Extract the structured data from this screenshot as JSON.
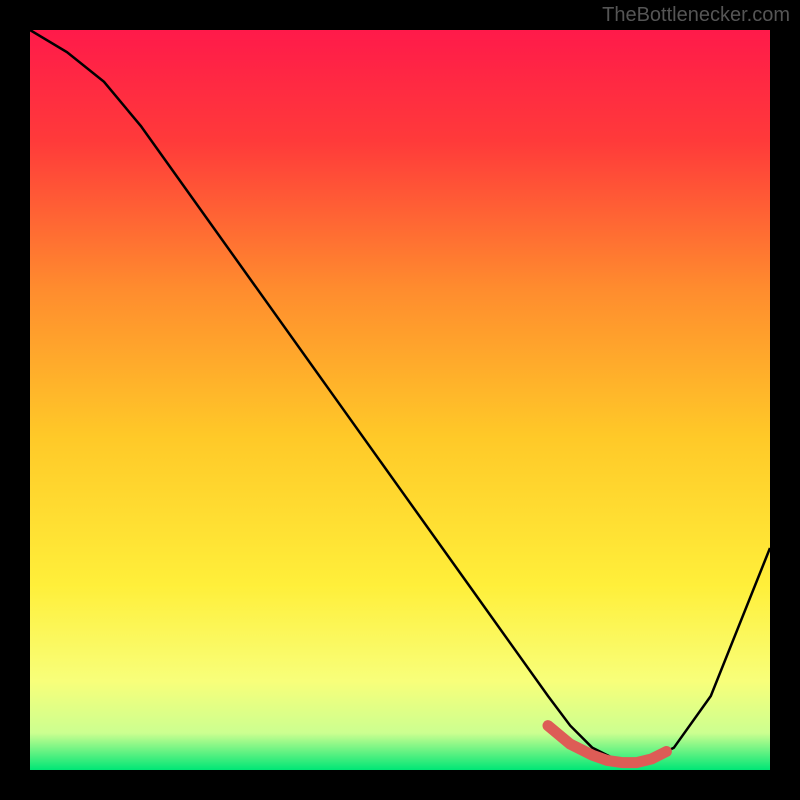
{
  "watermark": "TheBottlenecker.com",
  "chart_data": {
    "type": "line",
    "title": "",
    "xlabel": "",
    "ylabel": "",
    "xlim": [
      0,
      100
    ],
    "ylim": [
      0,
      100
    ],
    "series": [
      {
        "name": "curve",
        "x": [
          0,
          5,
          10,
          15,
          20,
          30,
          40,
          50,
          60,
          65,
          70,
          73,
          76,
          80,
          83,
          87,
          92,
          100
        ],
        "y": [
          100,
          97,
          93,
          87,
          80,
          66,
          52,
          38,
          24,
          17,
          10,
          6,
          3,
          1,
          1,
          3,
          10,
          30
        ]
      }
    ],
    "marker_segment": {
      "name": "highlight",
      "x": [
        70,
        73,
        76,
        78,
        80,
        82,
        84,
        86
      ],
      "y": [
        6,
        3.5,
        2,
        1.3,
        1,
        1,
        1.5,
        2.5
      ],
      "color": "#d9534f"
    },
    "gradient": {
      "top": "#ff1744",
      "mid_top": "#ff6f3c",
      "mid": "#ffc107",
      "mid_bottom": "#ffeb3b",
      "bottom_light": "#f4ff81",
      "bottom": "#00e676"
    }
  }
}
